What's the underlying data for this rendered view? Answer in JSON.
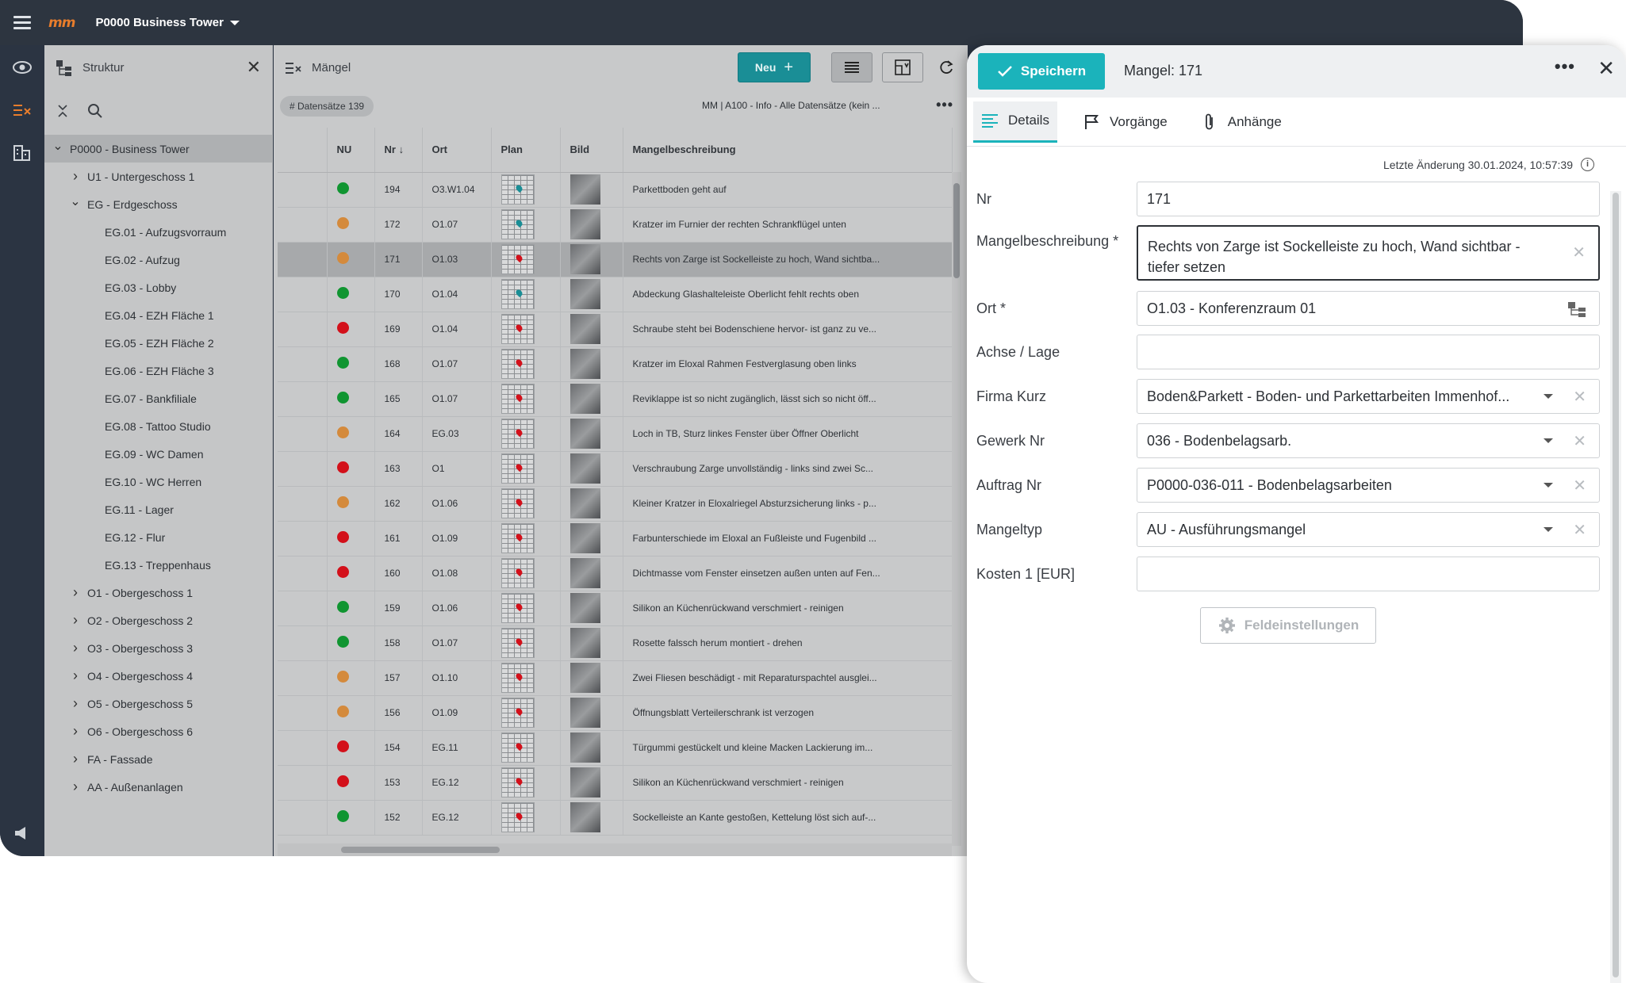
{
  "topbar": {
    "logo": "mm",
    "project": "P0000 Business Tower"
  },
  "tree": {
    "title": "Struktur",
    "items": [
      {
        "label": "P0000 - Business Tower",
        "level": 0,
        "chevron": "expanded",
        "selected": true
      },
      {
        "label": "U1 - Untergeschoss 1",
        "level": 1,
        "chevron": "collapsed"
      },
      {
        "label": "EG - Erdgeschoss",
        "level": 1,
        "chevron": "expanded"
      },
      {
        "label": "EG.01 - Aufzugsvorraum",
        "level": 2,
        "chevron": "none"
      },
      {
        "label": "EG.02 - Aufzug",
        "level": 2,
        "chevron": "none"
      },
      {
        "label": "EG.03 - Lobby",
        "level": 2,
        "chevron": "none"
      },
      {
        "label": "EG.04 - EZH Fläche 1",
        "level": 2,
        "chevron": "none"
      },
      {
        "label": "EG.05 - EZH Fläche 2",
        "level": 2,
        "chevron": "none"
      },
      {
        "label": "EG.06 - EZH Fläche 3",
        "level": 2,
        "chevron": "none"
      },
      {
        "label": "EG.07 - Bankfiliale",
        "level": 2,
        "chevron": "none"
      },
      {
        "label": "EG.08 - Tattoo Studio",
        "level": 2,
        "chevron": "none"
      },
      {
        "label": "EG.09 - WC Damen",
        "level": 2,
        "chevron": "none"
      },
      {
        "label": "EG.10 - WC Herren",
        "level": 2,
        "chevron": "none"
      },
      {
        "label": "EG.11 - Lager",
        "level": 2,
        "chevron": "none"
      },
      {
        "label": "EG.12 - Flur",
        "level": 2,
        "chevron": "none"
      },
      {
        "label": "EG.13 - Treppenhaus",
        "level": 2,
        "chevron": "none"
      },
      {
        "label": "O1 - Obergeschoss 1",
        "level": 1,
        "chevron": "collapsed"
      },
      {
        "label": "O2 - Obergeschoss 2",
        "level": 1,
        "chevron": "collapsed"
      },
      {
        "label": "O3 - Obergeschoss 3",
        "level": 1,
        "chevron": "collapsed"
      },
      {
        "label": "O4 - Obergeschoss 4",
        "level": 1,
        "chevron": "collapsed"
      },
      {
        "label": "O5 - Obergeschoss 5",
        "level": 1,
        "chevron": "collapsed"
      },
      {
        "label": "O6 - Obergeschoss 6",
        "level": 1,
        "chevron": "collapsed"
      },
      {
        "label": "FA - Fassade",
        "level": 1,
        "chevron": "collapsed"
      },
      {
        "label": "AA - Außenanlagen",
        "level": 1,
        "chevron": "collapsed"
      }
    ]
  },
  "list": {
    "title": "Mängel",
    "new_label": "Neu",
    "record_chip": "# Datensätze 139",
    "view_name": "MM | A100 - Info - Alle Datensätze (kein ...",
    "columns": {
      "nu": "NU",
      "nr": "Nr",
      "ort": "Ort",
      "plan": "Plan",
      "bild": "Bild",
      "desc": "Mangelbeschreibung"
    },
    "rows": [
      {
        "status": "green",
        "nr": "194",
        "ort": "O3.W1.04",
        "pin": "teal",
        "desc": "Parkettboden geht auf"
      },
      {
        "status": "orange",
        "nr": "172",
        "ort": "O1.07",
        "pin": "teal",
        "desc": "Kratzer im Furnier der rechten Schrankflügel unten"
      },
      {
        "status": "orange",
        "nr": "171",
        "ort": "O1.03",
        "pin": "red",
        "desc": "Rechts von Zarge ist Sockelleiste zu hoch, Wand sichtba...",
        "selected": true
      },
      {
        "status": "green",
        "nr": "170",
        "ort": "O1.04",
        "pin": "teal",
        "desc": "Abdeckung Glashalteleiste Oberlicht fehlt rechts oben"
      },
      {
        "status": "red",
        "nr": "169",
        "ort": "O1.04",
        "pin": "red",
        "desc": "Schraube steht bei Bodenschiene hervor- ist ganz zu ve..."
      },
      {
        "status": "green",
        "nr": "168",
        "ort": "O1.07",
        "pin": "red",
        "desc": "Kratzer im Eloxal Rahmen Festverglasung oben links"
      },
      {
        "status": "green",
        "nr": "165",
        "ort": "O1.07",
        "pin": "red",
        "desc": "Reviklappe ist so nicht zugänglich, lässt sich so nicht öff..."
      },
      {
        "status": "orange",
        "nr": "164",
        "ort": "EG.03",
        "pin": "red",
        "desc": "Loch in TB, Sturz linkes Fenster über Öffner Oberlicht"
      },
      {
        "status": "red",
        "nr": "163",
        "ort": "O1",
        "pin": "red",
        "desc": "Verschraubung Zarge unvollständig - links sind zwei Sc..."
      },
      {
        "status": "orange",
        "nr": "162",
        "ort": "O1.06",
        "pin": "red",
        "desc": "Kleiner Kratzer in Eloxalriegel Absturzsicherung links - p..."
      },
      {
        "status": "red",
        "nr": "161",
        "ort": "O1.09",
        "pin": "red",
        "desc": "Farbunterschiede im Eloxal an Fußleiste und Fugenbild ..."
      },
      {
        "status": "red",
        "nr": "160",
        "ort": "O1.08",
        "pin": "red",
        "desc": "Dichtmasse vom Fenster einsetzen außen unten auf Fen..."
      },
      {
        "status": "green",
        "nr": "159",
        "ort": "O1.06",
        "pin": "red",
        "desc": "Silikon an Küchenrückwand verschmiert - reinigen"
      },
      {
        "status": "green",
        "nr": "158",
        "ort": "O1.07",
        "pin": "red",
        "desc": "Rosette falssch herum montiert - drehen"
      },
      {
        "status": "orange",
        "nr": "157",
        "ort": "O1.10",
        "pin": "red",
        "desc": "Zwei Fliesen beschädigt - mit Reparaturspachtel ausglei..."
      },
      {
        "status": "orange",
        "nr": "156",
        "ort": "O1.09",
        "pin": "red",
        "desc": "Öffnungsblatt Verteilerschrank ist verzogen"
      },
      {
        "status": "red",
        "nr": "154",
        "ort": "EG.11",
        "pin": "red",
        "desc": "Türgummi gestückelt und kleine Macken Lackierung im..."
      },
      {
        "status": "red",
        "nr": "153",
        "ort": "EG.12",
        "pin": "red",
        "desc": "Silikon an Küchenrückwand verschmiert - reinigen"
      },
      {
        "status": "green",
        "nr": "152",
        "ort": "EG.12",
        "pin": "red",
        "desc": "Sockelleiste an Kante gestoßen, Kettelung löst sich auf-..."
      }
    ]
  },
  "detail": {
    "save_label": "Speichern",
    "title": "Mangel: 171",
    "tabs": [
      "Details",
      "Vorgänge",
      "Anhänge"
    ],
    "last_change": "Letzte Änderung 30.01.2024, 10:57:39",
    "fields": {
      "nr": {
        "label": "Nr",
        "value": "171"
      },
      "desc": {
        "label": "Mangelbeschreibung *",
        "value": "Rechts von Zarge ist Sockelleiste zu hoch, Wand sichtbar - tiefer setzen"
      },
      "ort": {
        "label": "Ort *",
        "value": "O1.03 - Konferenzraum 01"
      },
      "achse": {
        "label": "Achse / Lage",
        "value": ""
      },
      "firma": {
        "label": "Firma Kurz",
        "value": "Boden&Parkett - Boden- und Parkettarbeiten Immenhof..."
      },
      "gewerk": {
        "label": "Gewerk Nr",
        "value": "036 - Bodenbelagsarb."
      },
      "auftrag": {
        "label": "Auftrag Nr",
        "value": "P0000-036-011 - Bodenbelagsarbeiten"
      },
      "typ": {
        "label": "Mangeltyp",
        "value": "AU - Ausführungsmangel"
      },
      "kosten": {
        "label": "Kosten 1 [EUR]",
        "value": ""
      }
    },
    "field_settings_label": "Feldeinstellungen"
  },
  "colors": {
    "accent": "#1bb3bb",
    "new_button": "#1a8e96",
    "status_green": "#109531",
    "status_orange": "#d48a3c",
    "status_red": "#d3101a",
    "logo": "#e87d2c"
  }
}
